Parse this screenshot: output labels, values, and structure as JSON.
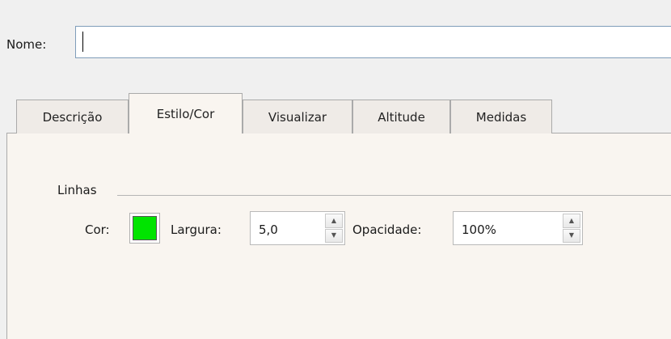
{
  "name_field": {
    "label": "Nome:",
    "value": ""
  },
  "tabs": [
    {
      "label": "Descrição",
      "active": false
    },
    {
      "label": "Estilo/Cor",
      "active": true
    },
    {
      "label": "Visualizar",
      "active": false
    },
    {
      "label": "Altitude",
      "active": false
    },
    {
      "label": "Medidas",
      "active": false
    }
  ],
  "lines_group": {
    "title": "Linhas",
    "color_label": "Cor:",
    "color_value": "#00e400",
    "width_label": "Largura:",
    "width_value": "5,0",
    "opacity_label": "Opacidade:",
    "opacity_value": "100%"
  },
  "icons": {
    "spin_up": "spin-up-arrow",
    "spin_down": "spin-down-arrow"
  }
}
